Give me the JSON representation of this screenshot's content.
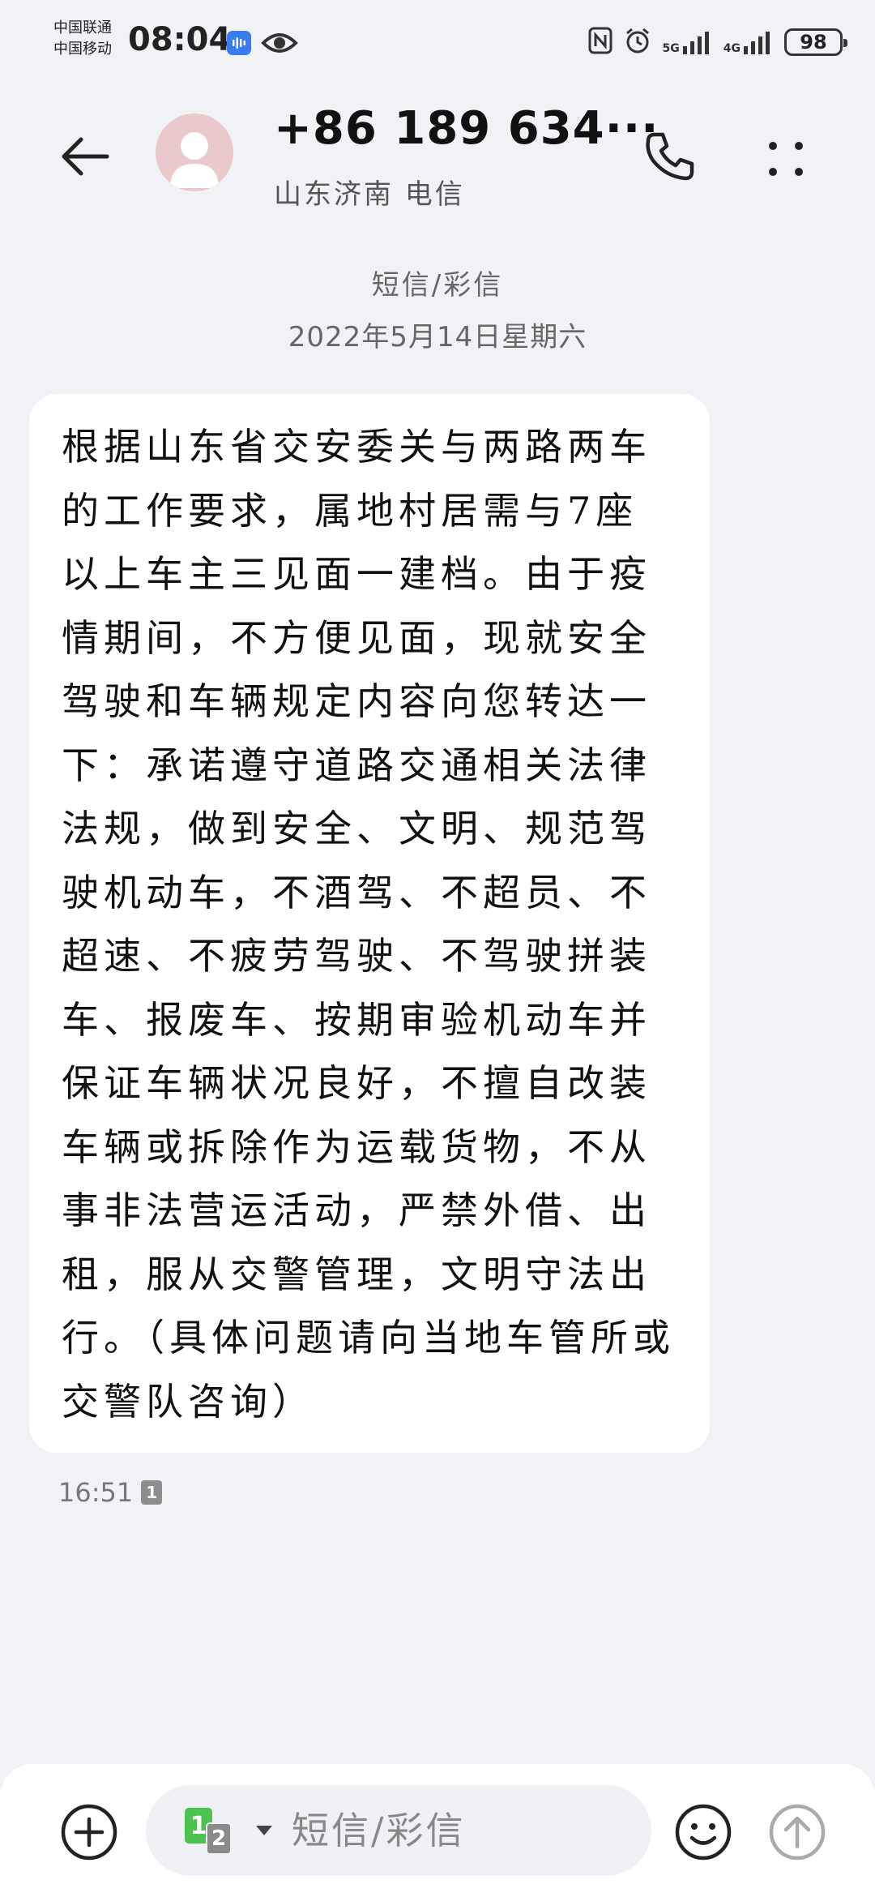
{
  "status_bar": {
    "carrier_1": "中国联通",
    "carrier_2": "中国移动",
    "time": "08:04",
    "net_1": "5G",
    "net_2": "4G",
    "battery": "98"
  },
  "header": {
    "contact_number": "+86 189 634···",
    "contact_location": "山东济南 电信",
    "icons": [
      "back-arrow-icon",
      "avatar",
      "phone-icon",
      "more-icon"
    ]
  },
  "thread": {
    "type_label": "短信/彩信",
    "date_label": "2022年5月14日星期六"
  },
  "message": {
    "text": "根据山东省交安委关与两路两车的工作要求，属地村居需与7座以上车主三见面一建档。由于疫情期间，不方便见面，现就安全驾驶和车辆规定内容向您转达一下：承诺遵守道路交通相关法律法规，做到安全、文明、规范驾驶机动车，不酒驾、不超员、不超速、不疲劳驾驶、不驾驶拼装车、报废车、按期审验机动车并保证车辆状况良好，不擅自改装车辆或拆除作为运载货物，不从事非法营运活动，严禁外借、出租，服从交警管理，文明守法出行。（具体问题请向当地车管所或交警队咨询）",
    "time": "16:51",
    "sim_badge": "1"
  },
  "composer": {
    "sim_1": "1",
    "sim_2": "2",
    "placeholder": "短信/彩信"
  },
  "colors": {
    "background": "#f1f2f5",
    "bubble": "#ffffff",
    "sim_green": "#4cc24f",
    "mic_blue": "#3a7bf0"
  }
}
